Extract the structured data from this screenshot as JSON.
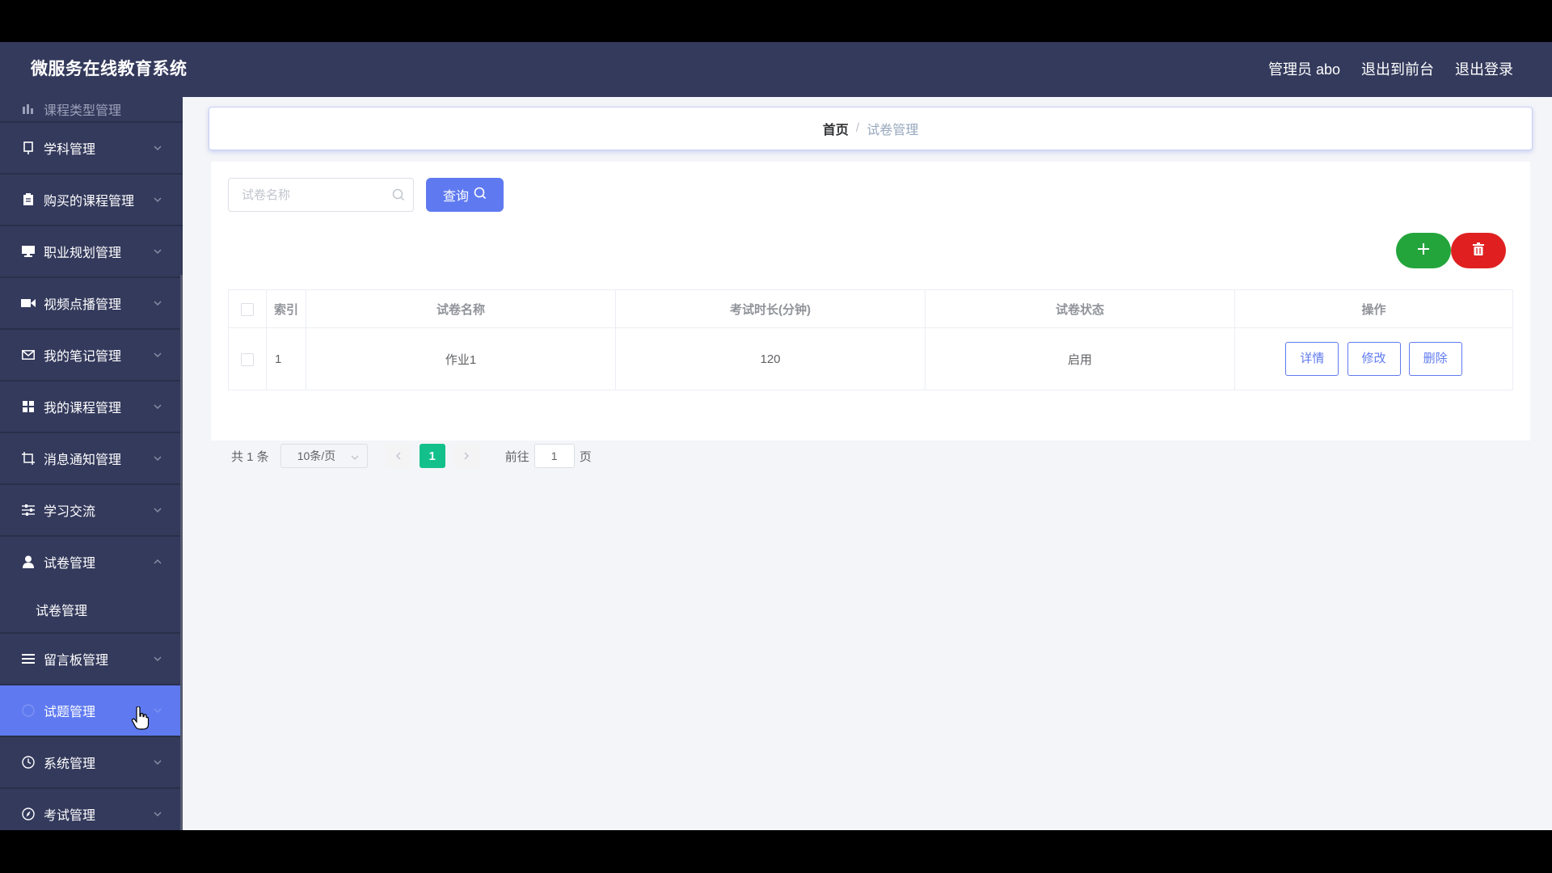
{
  "header": {
    "title": "微服务在线教育系统",
    "user": "管理员 abo",
    "back_to_front": "退出到前台",
    "logout": "退出登录"
  },
  "sidebar": {
    "partial_item": "课程类型管理",
    "items": [
      {
        "label": "学科管理",
        "icon": "book-icon"
      },
      {
        "label": "购买的课程管理",
        "icon": "clipboard-icon"
      },
      {
        "label": "职业规划管理",
        "icon": "monitor-icon"
      },
      {
        "label": "视频点播管理",
        "icon": "video-icon"
      },
      {
        "label": "我的笔记管理",
        "icon": "mail-icon"
      },
      {
        "label": "我的课程管理",
        "icon": "grid-icon"
      },
      {
        "label": "消息通知管理",
        "icon": "crop-icon"
      },
      {
        "label": "学习交流",
        "icon": "sliders-icon"
      },
      {
        "label": "试卷管理",
        "icon": "user-icon",
        "expanded": true,
        "submenu": [
          "试卷管理"
        ]
      },
      {
        "label": "留言板管理",
        "icon": "list-icon"
      },
      {
        "label": "试题管理",
        "icon": "circle-icon",
        "active": true
      },
      {
        "label": "系统管理",
        "icon": "clock-icon"
      },
      {
        "label": "考试管理",
        "icon": "compass-icon"
      }
    ]
  },
  "breadcrumb": {
    "home": "首页",
    "separator": "/",
    "current": "试卷管理"
  },
  "search": {
    "placeholder": "试卷名称",
    "button": "查询"
  },
  "table": {
    "columns": [
      "索引",
      "试卷名称",
      "考试时长(分钟)",
      "试卷状态",
      "操作"
    ],
    "rows": [
      {
        "index": "1",
        "name": "作业1",
        "duration": "120",
        "status": "启用"
      }
    ],
    "actions": {
      "detail": "详情",
      "edit": "修改",
      "delete": "删除"
    }
  },
  "pagination": {
    "total": "共 1 条",
    "page_size": "10条/页",
    "current_page": "1",
    "goto_label": "前往",
    "goto_value": "1",
    "page_suffix": "页"
  },
  "colors": {
    "primary": "#5f7af0",
    "sidebar": "#343a5c",
    "add": "#24a53c",
    "delete": "#e02020",
    "page_active": "#13c08b"
  }
}
